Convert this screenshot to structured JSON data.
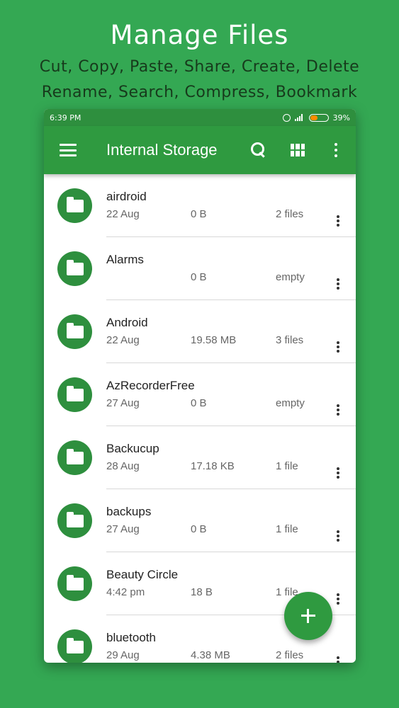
{
  "promo": {
    "title": "Manage Files",
    "line1": "Cut, Copy, Paste, Share, Create, Delete",
    "line2": "Rename, Search, Compress, Bookmark"
  },
  "status_bar": {
    "time": "6:39 PM",
    "battery": "39%",
    "battery_level": 0.39,
    "battery_color": "#ff8c00"
  },
  "toolbar": {
    "title": "Internal Storage",
    "icons": [
      "menu-icon",
      "search-icon",
      "grid-view-icon",
      "overflow-menu-icon"
    ]
  },
  "files": [
    {
      "name": "airdroid",
      "date": "22 Aug",
      "size": "0 B",
      "count": "2 files"
    },
    {
      "name": "Alarms",
      "date": "",
      "size": "0 B",
      "count": "empty"
    },
    {
      "name": "Android",
      "date": "22 Aug",
      "size": "19.58 MB",
      "count": "3 files"
    },
    {
      "name": "AzRecorderFree",
      "date": "27 Aug",
      "size": "0 B",
      "count": "empty"
    },
    {
      "name": "Backucup",
      "date": "28 Aug",
      "size": "17.18 KB",
      "count": "1 file"
    },
    {
      "name": "backups",
      "date": "27 Aug",
      "size": "0 B",
      "count": "1 file"
    },
    {
      "name": "Beauty Circle",
      "date": "4:42 pm",
      "size": "18 B",
      "count": "1 file"
    },
    {
      "name": "bluetooth",
      "date": "29 Aug",
      "size": "4.38 MB",
      "count": "2 files"
    }
  ],
  "colors": {
    "background": "#34a853",
    "toolbar": "#2f9a40",
    "folder": "#2e8f3e"
  }
}
